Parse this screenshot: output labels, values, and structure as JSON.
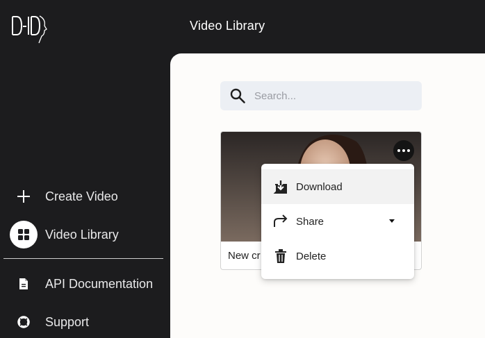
{
  "app": {
    "logo_text": "D-ID"
  },
  "header": {
    "title": "Video Library"
  },
  "sidebar": {
    "items": [
      {
        "label": "Create Video",
        "icon": "plus-icon"
      },
      {
        "label": "Video Library",
        "icon": "grid-icon",
        "active": true
      },
      {
        "label": "API Documentation",
        "icon": "document-icon"
      },
      {
        "label": "Support",
        "icon": "lifebuoy-icon"
      }
    ]
  },
  "search": {
    "placeholder": "Search...",
    "value": ""
  },
  "videos": [
    {
      "title": "New cr"
    }
  ],
  "context_menu": {
    "items": [
      {
        "label": "Download",
        "icon": "download-icon"
      },
      {
        "label": "Share",
        "icon": "share-icon"
      },
      {
        "label": "Delete",
        "icon": "trash-icon"
      }
    ]
  },
  "colors": {
    "sidebar_bg": "#1c1c1e",
    "main_bg": "#fdfcfa",
    "search_bg": "#eceff4"
  }
}
